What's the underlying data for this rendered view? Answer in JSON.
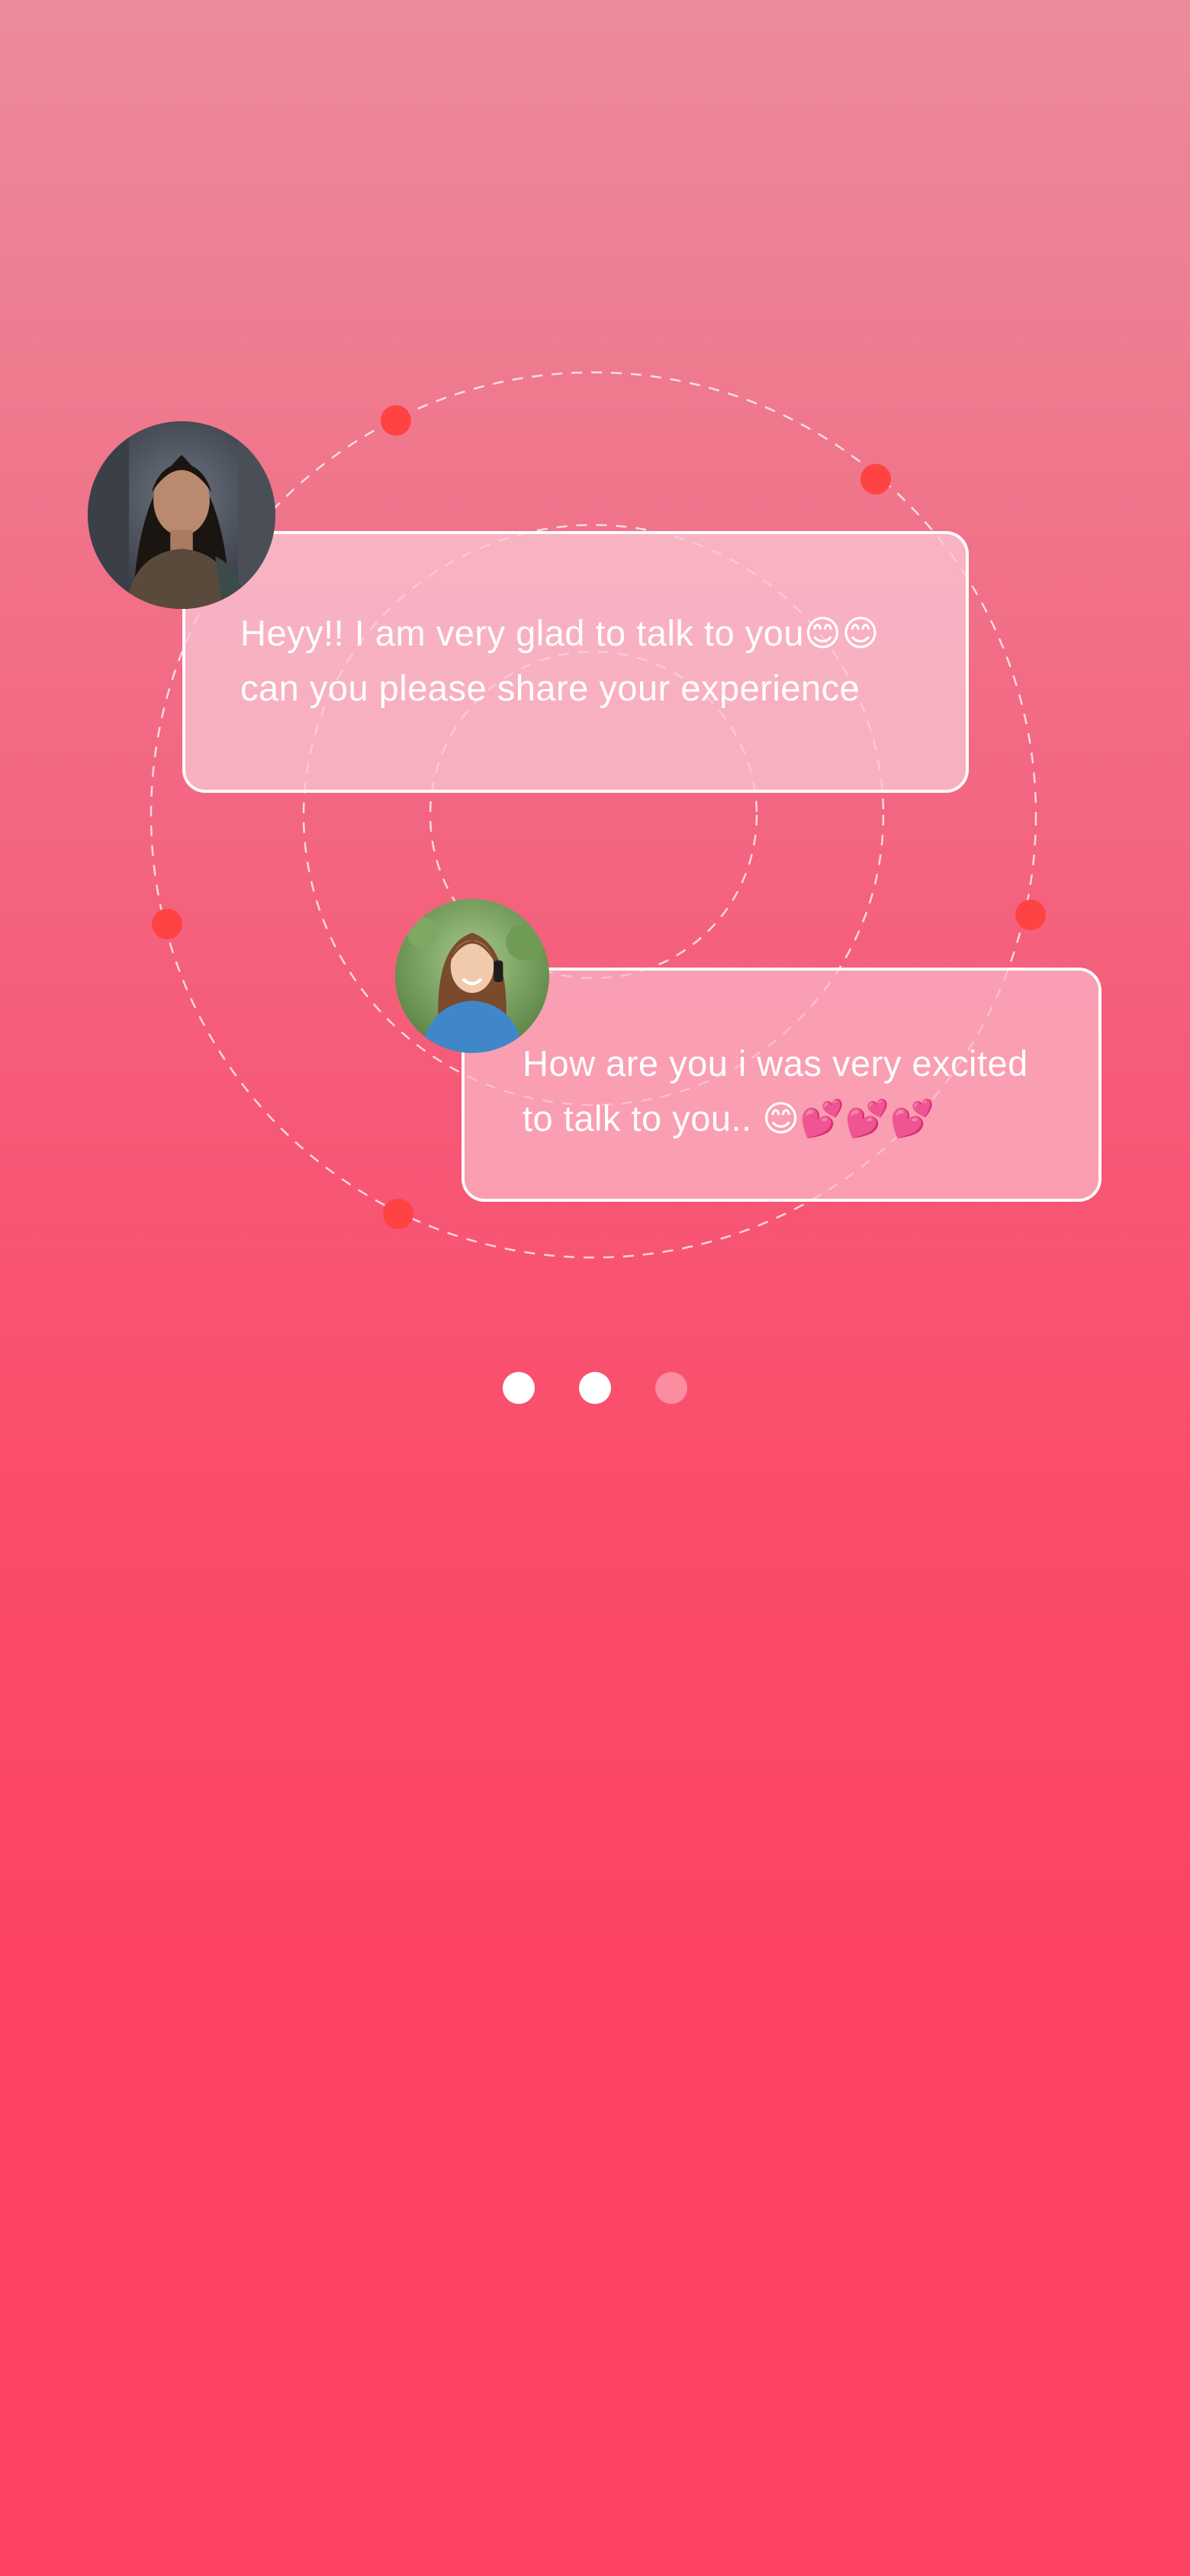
{
  "onboarding": {
    "messages": [
      {
        "lines": [
          "Heyy!! I am very glad to talk to you😊😊",
          "can you please share your experience"
        ]
      },
      {
        "lines": [
          "How are you i was very excited",
          "to talk to you.. 😊💕💕💕"
        ]
      }
    ],
    "pager": {
      "total": 3,
      "active_count": 2
    }
  },
  "colors": {
    "gradient_top": "#eb8b9b",
    "gradient_bottom": "#ff4264",
    "orbit_dot": "#ff4242",
    "bubble_border": "#ffffff"
  }
}
